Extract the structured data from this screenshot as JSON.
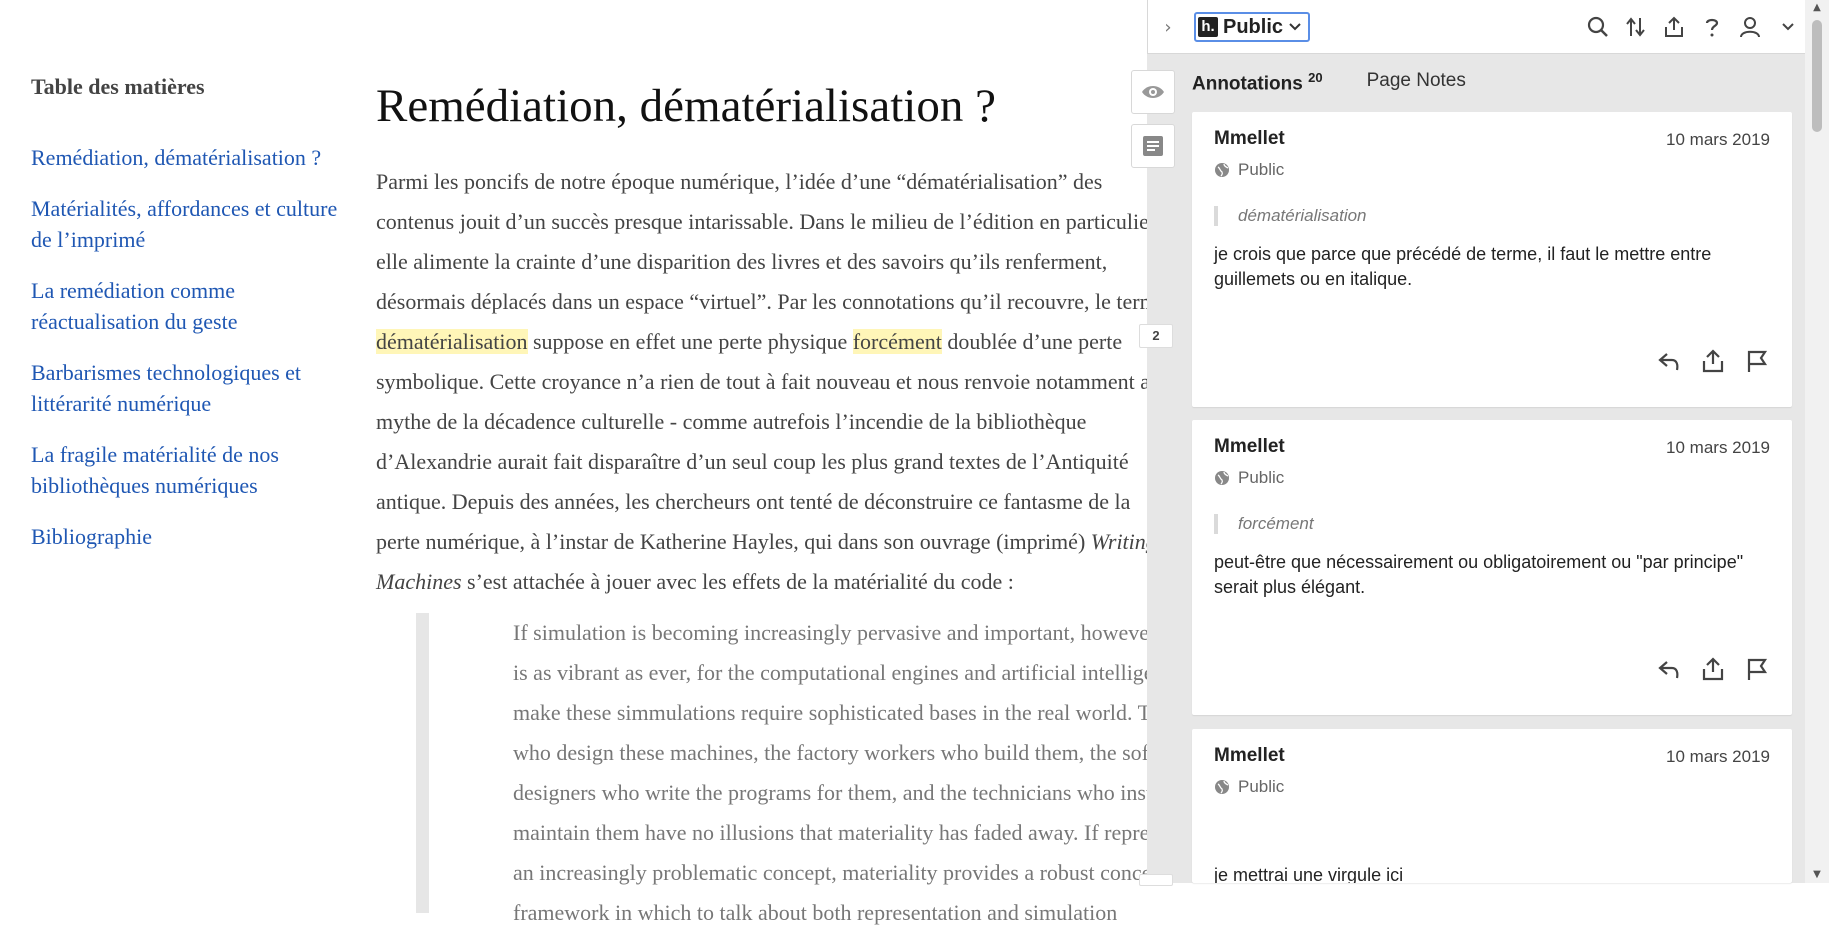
{
  "toc": {
    "title": "Table des matières",
    "items": [
      {
        "label": "Remédiation, dématérialisation ?"
      },
      {
        "label": "Matérialités, affordances et culture de l’imprimé"
      },
      {
        "label": "La remédiation comme réactualisation du geste"
      },
      {
        "label": "Barbarismes technologiques et littérarité numérique"
      },
      {
        "label": "La fragile matérialité de nos bibliothèques numériques"
      },
      {
        "label": "Bibliographie"
      }
    ]
  },
  "article": {
    "title": "Remédiation, dématérialisation ?",
    "p1": {
      "a": "Parmi les poncifs de notre époque numérique, l’idée d’une “dématérialisation” des contenus jouit d’un succès presque intarissable. Dans le milieu de l’édition en particulier, elle alimente la crainte d’une disparition des livres et des savoirs qu’ils renferment, désormais déplacés dans un espace “virtuel”. Par les connotations qu’il recouvre, le terme ",
      "hl1": "dématérialisation",
      "b": " suppose en effet une perte physique ",
      "hl2": "forcément",
      "c": " doublée d’une perte symbolique. Cette croyance n’a rien de tout à fait nouveau et nous renvoie notamment au mythe de la décadence culturelle - comme autrefois l’incendie de la bibliothèque d’Alexandrie aurait fait disparaître d’un seul coup les plus grand textes de l’Antiquité antique. Depuis des années, les chercheurs ont tenté de déconstruire ce fantasme de la perte numérique, à l’instar de Katherine Hayles, qui dans son ouvrage (imprimé) ",
      "italic": "Writing Machines",
      "d": " s’est attachée à jouer avec les effets de la matérialité du code :"
    },
    "blockquote": "If simulation is becoming increasingly pervasive and important, however, materiality is as vibrant as ever, for the computational engines and artificial intelligences that make these simmulations require sophisticated bases in the real world. The engineers who design these machines, the factory workers who build them, the software designers who write the programs for them, and the technicians who install and maintain them have no illusions that materiality has faded away. If representation is an increasingly problematic concept, materiality provides a robust conceptual framework in which to talk about both representation and simulation"
  },
  "sidebar": {
    "group": "Public",
    "logo_letter": "h.",
    "collapse_glyph": "›",
    "tabs": {
      "annotations_label": "Annotations",
      "annotations_count": "20",
      "page_notes_label": "Page Notes"
    },
    "bucket_count": "2",
    "annotations": [
      {
        "user": "Mmellet",
        "date": "10 mars 2019",
        "visibility": "Public",
        "quote": "dématérialisation",
        "body": "je crois que parce que précédé de terme, il faut le mettre entre guillemets ou en italique."
      },
      {
        "user": "Mmellet",
        "date": "10 mars 2019",
        "visibility": "Public",
        "quote": "forcément",
        "body": "peut-être que nécessairement ou obligatoirement ou \"par principe\" serait plus élégant."
      },
      {
        "user": "Mmellet",
        "date": "10 mars 2019",
        "visibility": "Public",
        "quote": "",
        "body": "je mettrai une virgule ici"
      }
    ]
  },
  "colors": {
    "link": "#1f57b3",
    "highlight": "#fff6b8",
    "sidebar_bg": "#e7e7e7",
    "focus": "#5a8ee6"
  }
}
